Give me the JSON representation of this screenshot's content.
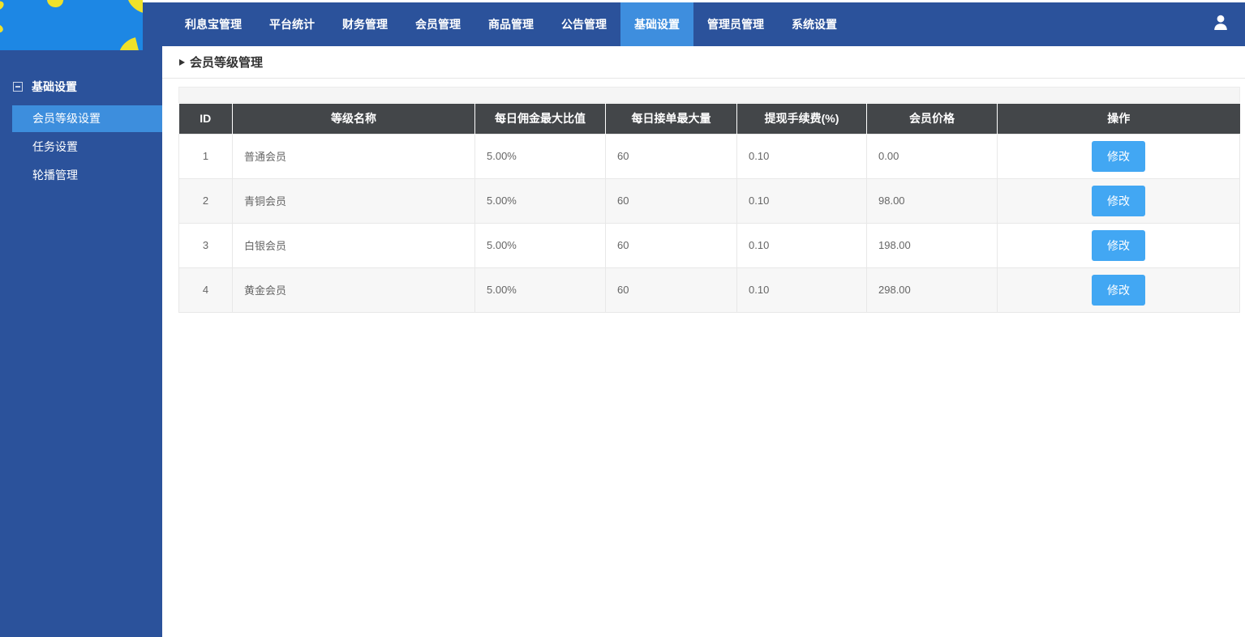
{
  "nav": {
    "items": [
      {
        "label": "利息宝管理",
        "active": false
      },
      {
        "label": "平台统计",
        "active": false
      },
      {
        "label": "财务管理",
        "active": false
      },
      {
        "label": "会员管理",
        "active": false
      },
      {
        "label": "商品管理",
        "active": false
      },
      {
        "label": "公告管理",
        "active": false
      },
      {
        "label": "基础设置",
        "active": true
      },
      {
        "label": "管理员管理",
        "active": false
      },
      {
        "label": "系统设置",
        "active": false
      }
    ]
  },
  "sidebar": {
    "group_label": "基础设置",
    "items": [
      {
        "label": "会员等级设置",
        "active": true
      },
      {
        "label": "任务设置",
        "active": false
      },
      {
        "label": "轮播管理",
        "active": false
      }
    ]
  },
  "breadcrumb": {
    "title": "会员等级管理"
  },
  "table": {
    "headers": [
      "ID",
      "等级名称",
      "每日佣金最大比值",
      "每日接单最大量",
      "提现手续费(%)",
      "会员价格",
      "操作"
    ],
    "action_label": "修改",
    "rows": [
      {
        "id": "1",
        "name": "普通会员",
        "commission": "5.00%",
        "orders": "60",
        "fee": "0.10",
        "price": "0.00"
      },
      {
        "id": "2",
        "name": "青铜会员",
        "commission": "5.00%",
        "orders": "60",
        "fee": "0.10",
        "price": "98.00"
      },
      {
        "id": "3",
        "name": "白银会员",
        "commission": "5.00%",
        "orders": "60",
        "fee": "0.10",
        "price": "198.00"
      },
      {
        "id": "4",
        "name": "黄金会员",
        "commission": "5.00%",
        "orders": "60",
        "fee": "0.10",
        "price": "298.00"
      }
    ]
  },
  "colors": {
    "nav_bg": "#2b529b",
    "nav_active_bg": "#3e8ede",
    "sidebar_bg": "#2b529b",
    "sidebar_active_bg": "#3d8edd",
    "logo_bg": "#1d87e4",
    "logo_accent": "#efe12a",
    "table_header_bg": "#434649",
    "button_bg": "#42a7f3",
    "stripe_bg": "#f7f7f7"
  }
}
